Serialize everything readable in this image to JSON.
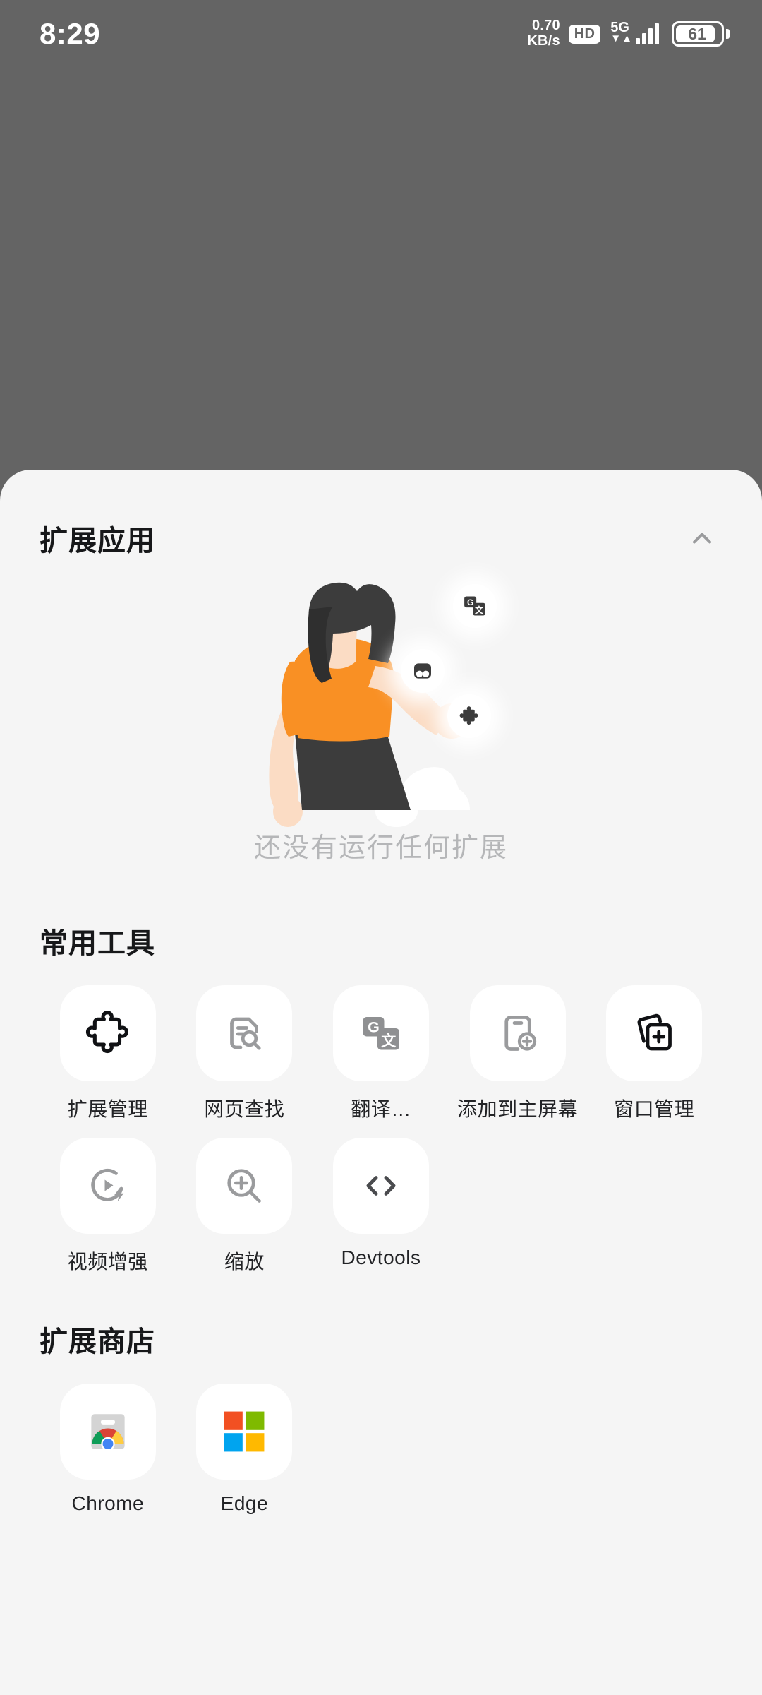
{
  "statusbar": {
    "clock": "8:29",
    "netspeed_value": "0.70",
    "netspeed_unit": "KB/s",
    "hd_badge": "HD",
    "network_type": "5G",
    "battery_percent": "61"
  },
  "sheet": {
    "extensions_section": {
      "title": "扩展应用",
      "collapse_icon": "chevron-up-icon",
      "empty_text": "还没有运行任何扩展",
      "floating_icons": [
        "translate-icon",
        "adblock-icon",
        "puzzle-piece-icon"
      ]
    },
    "tools_section": {
      "title": "常用工具",
      "items": [
        {
          "label": "扩展管理",
          "icon": "puzzle-piece-icon"
        },
        {
          "label": "网页查找",
          "icon": "document-search-icon"
        },
        {
          "label": "翻译…",
          "icon": "translate-icon"
        },
        {
          "label": "添加到主屏幕",
          "icon": "add-to-homescreen-icon"
        },
        {
          "label": "窗口管理",
          "icon": "window-manager-icon"
        },
        {
          "label": "视频增强",
          "icon": "video-boost-icon"
        },
        {
          "label": "缩放",
          "icon": "zoom-in-icon"
        },
        {
          "label": "Devtools",
          "icon": "code-brackets-icon"
        }
      ]
    },
    "store_section": {
      "title": "扩展商店",
      "items": [
        {
          "label": "Chrome",
          "icon": "chrome-webstore-icon"
        },
        {
          "label": "Edge",
          "icon": "microsoft-edge-addons-icon"
        }
      ]
    }
  },
  "colors": {
    "backdrop": "#646464",
    "sheet_bg": "#f5f5f5",
    "tile_bg": "#ffffff",
    "text_primary": "#17181a",
    "text_secondary": "#222326",
    "text_muted": "#b5b6b8",
    "illustration_orange": "#f99024",
    "illustration_dark": "#3c3c3c",
    "illustration_skin": "#fbdcc4"
  }
}
